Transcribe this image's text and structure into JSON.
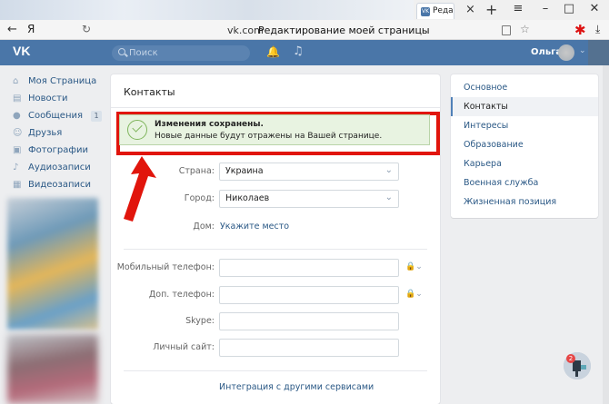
{
  "browser": {
    "tab_label": "Реда",
    "tab_close": "×",
    "new_tab": "+",
    "win_menu": "≡",
    "win_minimize": "–",
    "win_maximize": "□",
    "win_close": "✕",
    "back": "←",
    "logo": "Я",
    "reload": "↻",
    "url_domain": "vk.com",
    "page_title": "Редактирование моей страницы",
    "star": "☆",
    "download": "⤓"
  },
  "header": {
    "logo": "VK",
    "search_placeholder": "Поиск",
    "bell": "🔔",
    "music": "♫",
    "user_name": "Ольга",
    "chevron": "⌄",
    "brand_color": "#4a76a8"
  },
  "left_menu": {
    "items": [
      {
        "label": "Моя Страница",
        "icon": "⌂"
      },
      {
        "label": "Новости",
        "icon": "▤"
      },
      {
        "label": "Сообщения",
        "icon": "●",
        "count": "1"
      },
      {
        "label": "Друзья",
        "icon": "☺"
      },
      {
        "label": "Фотографии",
        "icon": "▣"
      },
      {
        "label": "Аудиозаписи",
        "icon": "♪"
      },
      {
        "label": "Видеозаписи",
        "icon": "▦"
      }
    ]
  },
  "main": {
    "title": "Контакты",
    "banner": {
      "title": "Изменения сохранены.",
      "text": "Новые данные будут отражены на Вашей странице.",
      "color": "#e8f3e1"
    },
    "highlight_color": "#e1150c",
    "location": {
      "country_label": "Страна:",
      "country_value": "Украина",
      "city_label": "Город:",
      "city_value": "Николаев",
      "home_label": "Дом:",
      "home_link": "Укажите место"
    },
    "contacts": {
      "mobile_label": "Мобильный телефон:",
      "extra_phone_label": "Доп. телефон:",
      "skype_label": "Skype:",
      "site_label": "Личный сайт:",
      "integration_link": "Интеграция с другими сервисами"
    },
    "chevron": "⌄",
    "privacy_icon": "🔒⌄"
  },
  "right_menu": {
    "items": [
      {
        "label": "Основное",
        "active": false
      },
      {
        "label": "Контакты",
        "active": true
      },
      {
        "label": "Интересы",
        "active": false
      },
      {
        "label": "Образование",
        "active": false
      },
      {
        "label": "Карьера",
        "active": false
      },
      {
        "label": "Военная служба",
        "active": false
      },
      {
        "label": "Жизненная позиция",
        "active": false
      }
    ]
  },
  "chat": {
    "badge": "2"
  }
}
